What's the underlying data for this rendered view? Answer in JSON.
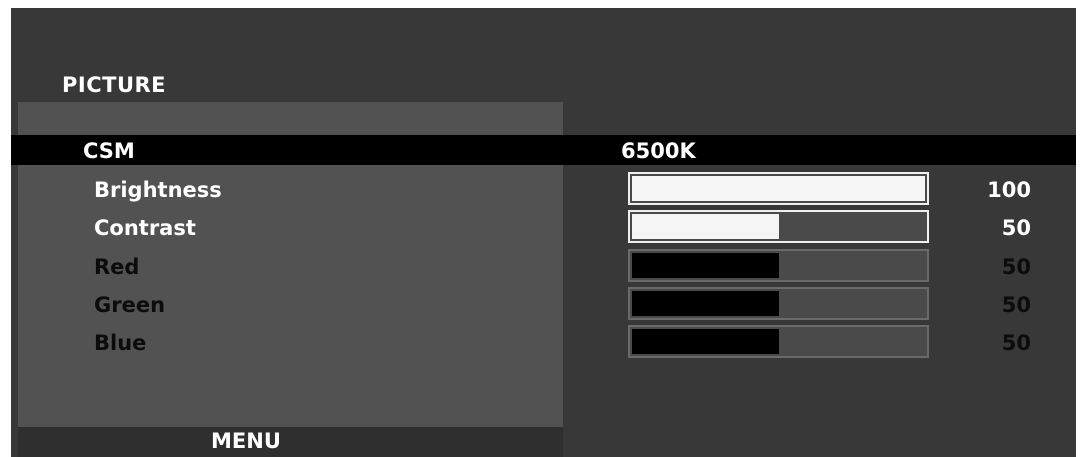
{
  "menu": {
    "title": "PICTURE",
    "footer": "MENU"
  },
  "csm": {
    "label": "CSM",
    "value": "6500K"
  },
  "rows": [
    {
      "label": "Brightness",
      "value": "100",
      "level": 1.0,
      "state": "active"
    },
    {
      "label": "Contrast",
      "value": "50",
      "level": 0.5,
      "state": "active"
    },
    {
      "label": "Red",
      "value": "50",
      "level": 0.5,
      "state": "dim"
    },
    {
      "label": "Green",
      "value": "50",
      "level": 0.5,
      "state": "dim"
    },
    {
      "label": "Blue",
      "value": "50",
      "level": 0.5,
      "state": "dim"
    }
  ],
  "colors": {
    "background": "#383838",
    "panel": "#525252",
    "highlight": "#000000",
    "active_text": "#ffffff",
    "dim_text": "#0c0c0c"
  }
}
